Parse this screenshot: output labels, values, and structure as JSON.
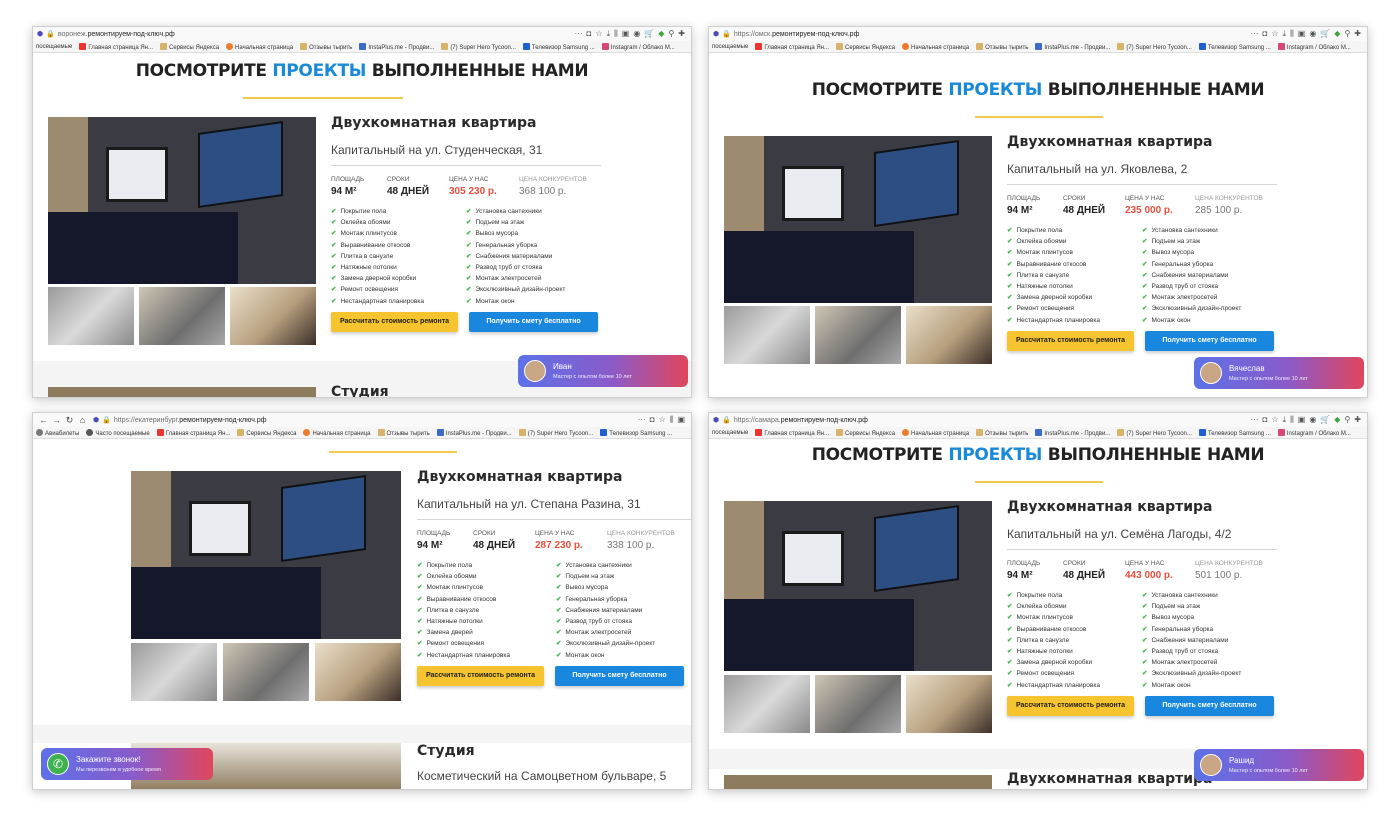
{
  "bookmarks_a": [
    "посещаемые",
    "Главная страница Ян...",
    "Сервисы Яндекса",
    "Начальная страница",
    "Отзывы тырить",
    "InstaPlus.me - Продви...",
    "(7) Super Hero Tycoon...",
    "Телевизор Samsung ...",
    "Instagram / Облако М..."
  ],
  "bookmarks_c": [
    "Авиабилеты",
    "Часто посещаемые",
    "Главная страница Ян...",
    "Сервисы Яндекса",
    "Начальная страница",
    "Отзывы тырить",
    "InstaPlus.me - Продви...",
    "(7) Super Hero Tycoon...",
    "Телевизор Samsung ..."
  ],
  "heading": {
    "part1": "ПОСМОТРИТЕ ",
    "accent": "ПРОЕКТЫ",
    "part2": " ВЫПОЛНЕННЫЕ НАМИ"
  },
  "stat_labels": {
    "area": "ПЛОЩАДЬ",
    "term": "СРОКИ",
    "our_price": "ЦЕНА У НАС",
    "competitor_price": "ЦЕНА КОНКУРЕНТОВ"
  },
  "area_value": "94 М²",
  "term_value": "48 ДНЕЙ",
  "features_left": [
    "Покрытие пола",
    "Оклейка обоями",
    "Монтаж плинтусов",
    "Выравнивание откосов",
    "Плитка в санузле",
    "Натяжные потолки",
    "Замена дверной коробки",
    "Ремонт освещения",
    "Нестандартная планировка"
  ],
  "features_left_c": [
    "Покрытие пола",
    "Оклейка обоями",
    "Монтаж плинтусов",
    "Выравнивание откосов",
    "Плитка в санузле",
    "Натяжные потолки",
    "Замена дверей",
    "Ремонт освещения",
    "Нестандартная планировка"
  ],
  "features_right": [
    "Установка сантехники",
    "Подъем на этаж",
    "Вывоз мусора",
    "Генеральная уборка",
    "Снабжения материалами",
    "Развод труб от стояка",
    "Монтаж электросетей",
    "Эксклюзивный дизайн-проект",
    "Монтаж окон"
  ],
  "buttons": {
    "calc": "Рассчитать стоимость ремонта",
    "estimate": "Получить смету бесплатно"
  },
  "chat_role": "Мастер с опытом более 10 лет",
  "screens": {
    "voronezh": {
      "url_prefix": "воронеж.",
      "url_main": "ремонтируем-под-ключ.рф",
      "title": "Двухкомнатная квартира",
      "subtitle": "Капитальный на ул. Студенческая, 31",
      "price": "305 230 р.",
      "competitor": "368 100 р.",
      "agent": "Иван",
      "next_title": "Студия"
    },
    "omsk": {
      "url_prefix": "https://омск.",
      "url_main": "ремонтируем-под-ключ.рф",
      "title": "Двухкомнатная квартира",
      "subtitle": "Капитальный на ул. Яковлева, 2",
      "price": "235 000 р.",
      "competitor": "285 100 р.",
      "agent": "Вячеслав"
    },
    "ekb": {
      "url_prefix": "https://екатеринбург.",
      "url_main": "ремонтируем-под-ключ.рф",
      "title": "Двухкомнатная квартира",
      "subtitle": "Капитальный на ул. Степана Разина, 31",
      "price": "287 230 р.",
      "competitor": "338 100 р.",
      "callback_title": "Закажите звонок!",
      "callback_sub": "Мы перезвоним в удобное время",
      "next_title": "Студия",
      "next_subtitle": "Косметический на Самоцветном бульваре, 5"
    },
    "samara": {
      "url_prefix": "https://самара.",
      "url_main": "ремонтируем-под-ключ.рф",
      "title": "Двухкомнатная квартира",
      "subtitle": "Капитальный на ул. Семёна Лагоды, 4/2",
      "price": "443 000 р.",
      "competitor": "501 100 р.",
      "agent": "Рашид",
      "next_title": "Двухкомнатная квартира"
    }
  }
}
